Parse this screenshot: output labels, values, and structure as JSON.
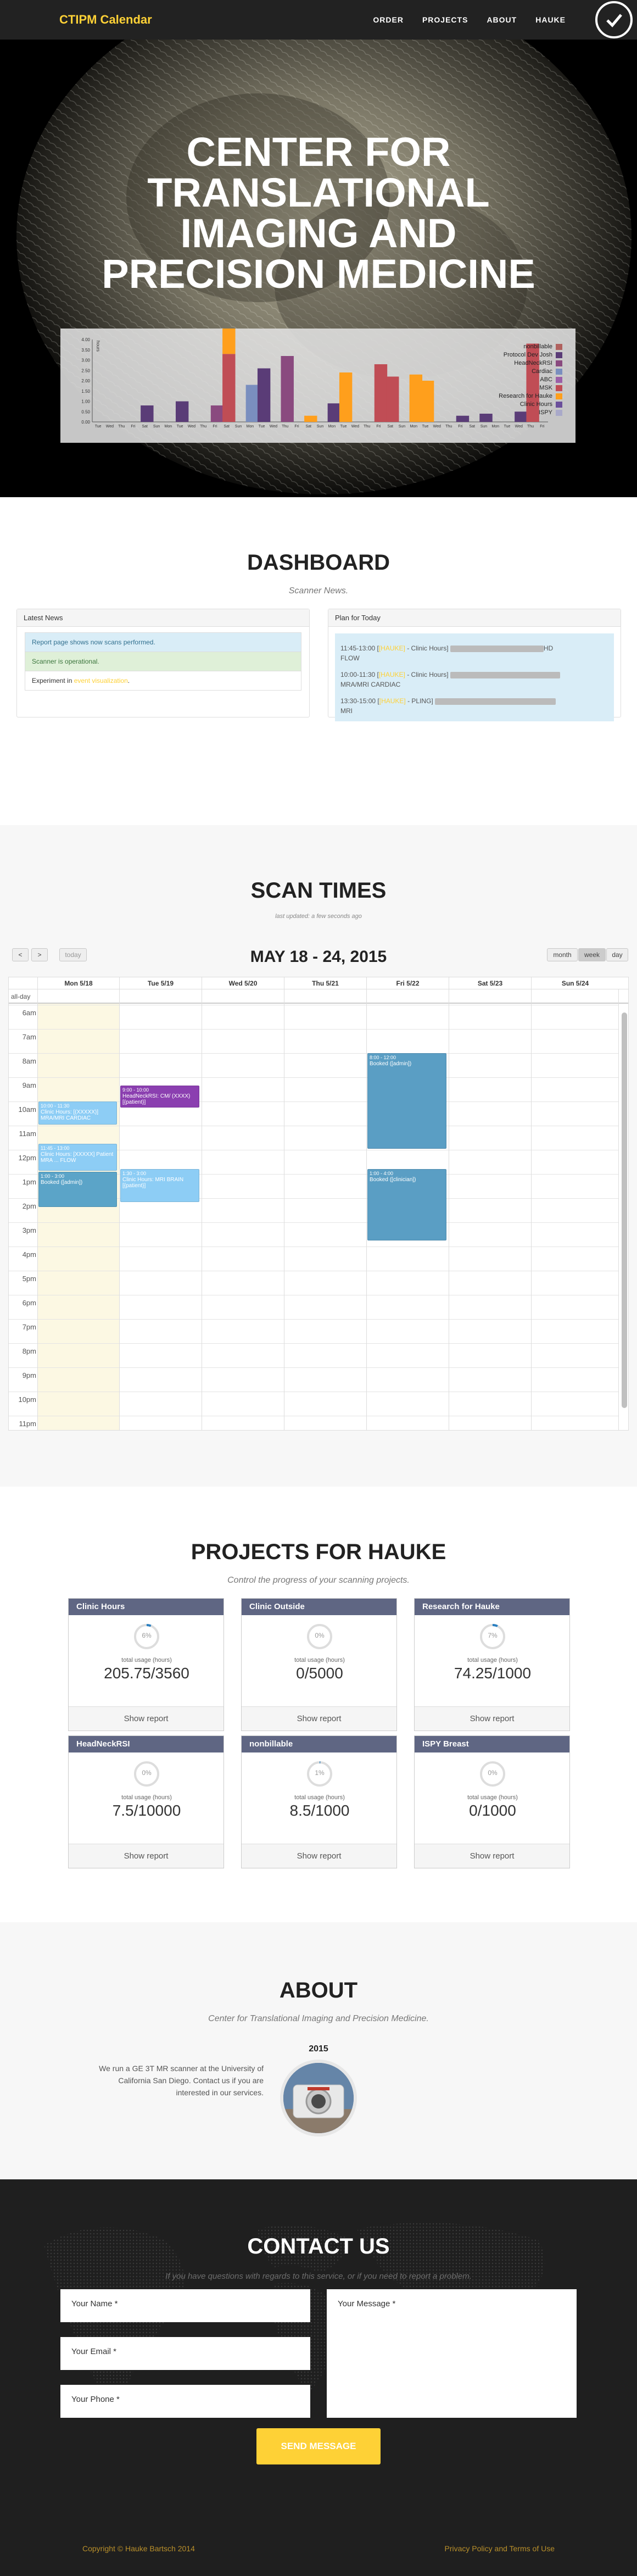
{
  "nav": {
    "brand": "CTIPM Calendar",
    "links": [
      "ORDER",
      "PROJECTS",
      "ABOUT",
      "HAUKE"
    ]
  },
  "hero": {
    "title_lines": [
      "CENTER FOR",
      "TRANSLATIONAL",
      "IMAGING AND",
      "PRECISION MEDICINE"
    ],
    "chart_data": {
      "type": "bar",
      "ylabel": "hours",
      "yticks": [
        "4.00",
        "3.50",
        "3.00",
        "2.50",
        "2.00",
        "1.50",
        "1.00",
        "0.50",
        "0.00"
      ],
      "ylim": [
        0,
        4
      ],
      "categories": [
        "Tue",
        "Wed",
        "Thu",
        "Fri",
        "Sat",
        "Sun",
        "Mon",
        "Tue",
        "Wed",
        "Thu",
        "Fri",
        "Sat",
        "Sun",
        "Mon",
        "Tue",
        "Wed",
        "Thu",
        "Fri",
        "Sat",
        "Sun",
        "Mon",
        "Tue",
        "Wed",
        "Thu",
        "Fri",
        "Sat",
        "Sun",
        "Mon",
        "Tue",
        "Wed",
        "Thu",
        "Fri",
        "Sat",
        "Sun",
        "Mon",
        "Tue",
        "Wed",
        "Thu",
        "Fri"
      ],
      "legend": [
        "nonbillable",
        "Protocol Dev Josh",
        "HeadNeckRSI",
        "Cardiac",
        "ABC",
        "MSK",
        "Research for Hauke",
        "Clinic Hours",
        "ISPY"
      ],
      "legend_colors": [
        "#b0615e",
        "#5a3c77",
        "#8a4a7f",
        "#7a8fbf",
        "#9b5fa8",
        "#c04d55",
        "#ff9f1c",
        "#6b4f9b",
        "#a9a9c9"
      ],
      "bars": [
        {
          "x": 4,
          "value": 0.8,
          "series": 1
        },
        {
          "x": 7,
          "value": 1.0,
          "series": 1
        },
        {
          "x": 10,
          "value": 0.8,
          "series": 2
        },
        {
          "x": 11,
          "value": 3.3,
          "series": 5,
          "stack": [
            {
              "value": 1.6,
              "series": 6
            },
            {
              "value": 0.8,
              "series": 1
            }
          ]
        },
        {
          "x": 13,
          "value": 1.8,
          "series": 3
        },
        {
          "x": 14,
          "value": 2.6,
          "series": 1
        },
        {
          "x": 16,
          "value": 3.2,
          "series": 2
        },
        {
          "x": 18,
          "value": 0.3,
          "series": 6
        },
        {
          "x": 20,
          "value": 0.9,
          "series": 1
        },
        {
          "x": 21,
          "value": 2.4,
          "series": 6
        },
        {
          "x": 24,
          "value": 2.8,
          "series": 5
        },
        {
          "x": 25,
          "value": 2.2,
          "series": 5
        },
        {
          "x": 27,
          "value": 2.3,
          "series": 6
        },
        {
          "x": 28,
          "value": 2.0,
          "series": 6
        },
        {
          "x": 31,
          "value": 0.3,
          "series": 1
        },
        {
          "x": 33,
          "value": 0.4,
          "series": 1
        },
        {
          "x": 36,
          "value": 0.5,
          "series": 1
        },
        {
          "x": 37,
          "value": 3.8,
          "series": 5
        }
      ]
    }
  },
  "dashboard": {
    "title": "DASHBOARD",
    "subtitle": "Scanner News.",
    "latest_news": {
      "heading": "Latest News",
      "items": [
        {
          "text": "Report page shows now scans performed.",
          "type": "info"
        },
        {
          "text": "Scanner is operational.",
          "type": "ok"
        },
        {
          "text_before": "Experiment in ",
          "link": "event visualization",
          "text_after": ".",
          "type": "plain"
        }
      ]
    },
    "plan": {
      "heading": "Plan for Today",
      "items": [
        {
          "time": "11:45-13:00",
          "tag": "[HAUKE]",
          "label": " - Clinic Hours] ",
          "tail": "FLOW",
          "suffix": "HD"
        },
        {
          "time": "10:00-11:30",
          "tag": "[HAUKE]",
          "label": " - Clinic Hours] ",
          "tail": "MRA/MRI CARDIAC",
          "suffix": ""
        },
        {
          "time": "13:30-15:00",
          "tag": "[HAUKE]",
          "label": " - PLING] ",
          "tail": "MRI",
          "suffix": ""
        }
      ]
    }
  },
  "scan": {
    "title": "SCAN TIMES",
    "updated": "last updated: a few seconds ago",
    "prev": "<",
    "next": ">",
    "today": "today",
    "range": "MAY 18 - 24, 2015",
    "views": [
      "month",
      "week",
      "day"
    ],
    "active_view": "week",
    "allday": "all-day",
    "days": [
      "Mon 5/18",
      "Tue 5/19",
      "Wed 5/20",
      "Thu 5/21",
      "Fri 5/22",
      "Sat 5/23",
      "Sun 5/24"
    ],
    "hours": [
      "6am",
      "7am",
      "8am",
      "9am",
      "10am",
      "11am",
      "12pm",
      "1pm",
      "2pm",
      "3pm",
      "4pm",
      "5pm",
      "6pm",
      "7pm",
      "8pm",
      "9pm",
      "10pm",
      "11pm"
    ],
    "events": [
      {
        "day": 0,
        "start": 10.0,
        "end": 11.0,
        "time": "10:00 - 11:30",
        "title": "Clinic Hours: [(XXXXX)] MRA/MRI CARDIAC",
        "color": "#8dcdf5"
      },
      {
        "day": 0,
        "start": 11.75,
        "end": 12.9,
        "time": "11:45 - 13:00",
        "title": "Clinic Hours: [XXXXX] Patient MRA ... FLOW",
        "color": "#8dcdf5"
      },
      {
        "day": 0,
        "start": 12.9,
        "end": 14.4,
        "time": "1:00 - 3:00",
        "title": "Booked ([admin])",
        "color": "#5ba4c8"
      },
      {
        "day": 1,
        "start": 9.35,
        "end": 10.3,
        "time": "9:00 - 10:00",
        "title": "HeadNeckRSI: CM/ (XXXX) [{patient}]",
        "color": "#8b3fb0"
      },
      {
        "day": 1,
        "start": 12.8,
        "end": 14.2,
        "time": "1:30 - 3:00",
        "title": "Clinic Hours: MRI BRAIN [{patient}]",
        "color": "#8dcdf5"
      },
      {
        "day": 4,
        "start": 8.0,
        "end": 12.0,
        "time": "8:00 - 12:00",
        "title": "Booked ([admin])",
        "color": "#5a9ec4"
      },
      {
        "day": 4,
        "start": 12.8,
        "end": 15.8,
        "time": "1:00 - 4:00",
        "title": "Booked ([clinician])",
        "color": "#5a9ec4"
      }
    ]
  },
  "projects": {
    "title": "PROJECTS FOR HAUKE",
    "subtitle": "Control the progress of your scanning projects.",
    "usage_label": "total usage (hours)",
    "button": "Show report",
    "cards": [
      {
        "name": "Clinic Hours",
        "pct": "6%",
        "fraction": 0.06,
        "value": "205.75/3560"
      },
      {
        "name": "Clinic Outside",
        "pct": "0%",
        "fraction": 0.0,
        "value": "0/5000"
      },
      {
        "name": "Research for Hauke",
        "pct": "7%",
        "fraction": 0.07,
        "value": "74.25/1000"
      },
      {
        "name": "HeadNeckRSI",
        "pct": "0%",
        "fraction": 0.0,
        "value": "7.5/10000"
      },
      {
        "name": "nonbillable",
        "pct": "1%",
        "fraction": 0.01,
        "value": "8.5/1000"
      },
      {
        "name": "ISPY Breast",
        "pct": "0%",
        "fraction": 0.0,
        "value": "0/1000"
      }
    ]
  },
  "about": {
    "title": "ABOUT",
    "subtitle": "Center for Translational Imaging and Precision Medicine.",
    "year": "2015",
    "text": "We run a GE 3T MR scanner at the University of California San Diego. Contact us if you are interested in our services."
  },
  "contact": {
    "title": "CONTACT US",
    "subtitle": "If you have questions with regards to this service, or if you need to report a problem.",
    "name_placeholder": "Your Name *",
    "email_placeholder": "Your Email *",
    "phone_placeholder": "Your Phone *",
    "message_placeholder": "Your Message *",
    "send": "SEND MESSAGE",
    "copyright": "Copyright © Hauke Bartsch 2014",
    "footer_links": "Privacy Policy and Terms of Use"
  },
  "colors": {
    "accent": "#fed136",
    "nav_bg": "#222222",
    "project_head": "#5f6683"
  }
}
